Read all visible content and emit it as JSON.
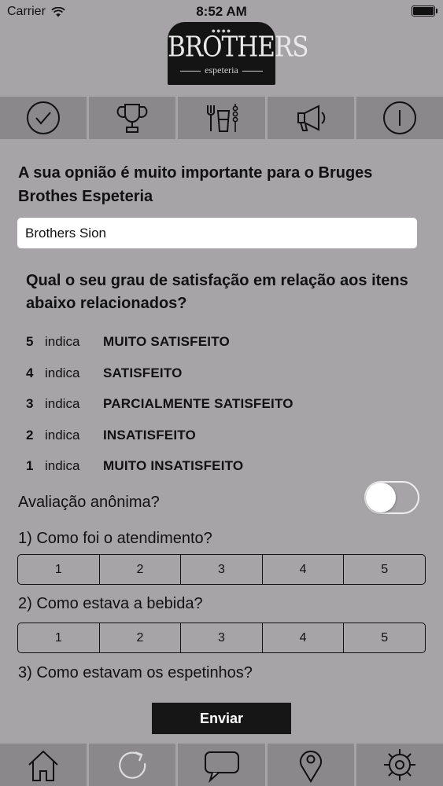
{
  "status_bar": {
    "carrier": "Carrier",
    "time": "8:52 AM"
  },
  "logo": {
    "dots": "●●●●",
    "brand": "BROTHERS",
    "subtitle": "espeteria"
  },
  "top_tabs": [
    {
      "icon": "checkmark-circle-icon"
    },
    {
      "icon": "trophy-icon"
    },
    {
      "icon": "menu-utensils-icon"
    },
    {
      "icon": "megaphone-icon"
    },
    {
      "icon": "info-icon"
    }
  ],
  "survey": {
    "intro": "A sua opnião é muito importante para o Bruges Brothes Espeteria",
    "unit_value": "Brothers Sion",
    "question_heading": "Qual o seu grau de satisfação em relação aos itens abaixo relacionados?",
    "scale": [
      {
        "num": "5",
        "word": "indica",
        "desc": "MUITO SATISFEITO"
      },
      {
        "num": "4",
        "word": "indica",
        "desc": "SATISFEITO"
      },
      {
        "num": "3",
        "word": "indica",
        "desc": "PARCIALMENTE SATISFEITO"
      },
      {
        "num": "2",
        "word": "indica",
        "desc": "INSATISFEITO"
      },
      {
        "num": "1",
        "word": "indica",
        "desc": "MUITO INSATISFEITO"
      }
    ],
    "anonymous_label": "Avaliação anônima?",
    "anonymous_on": false,
    "questions": [
      {
        "text": "1) Como foi o atendimento?",
        "options": [
          "1",
          "2",
          "3",
          "4",
          "5"
        ]
      },
      {
        "text": "2) Como estava a bebida?",
        "options": [
          "1",
          "2",
          "3",
          "4",
          "5"
        ]
      },
      {
        "text": "3) Como estavam os espetinhos?"
      }
    ],
    "submit_label": "Enviar"
  },
  "bottom_tabs": [
    {
      "icon": "home-icon"
    },
    {
      "icon": "refresh-icon"
    },
    {
      "icon": "chat-bubble-icon"
    },
    {
      "icon": "map-pin-icon"
    },
    {
      "icon": "settings-gear-icon"
    }
  ]
}
